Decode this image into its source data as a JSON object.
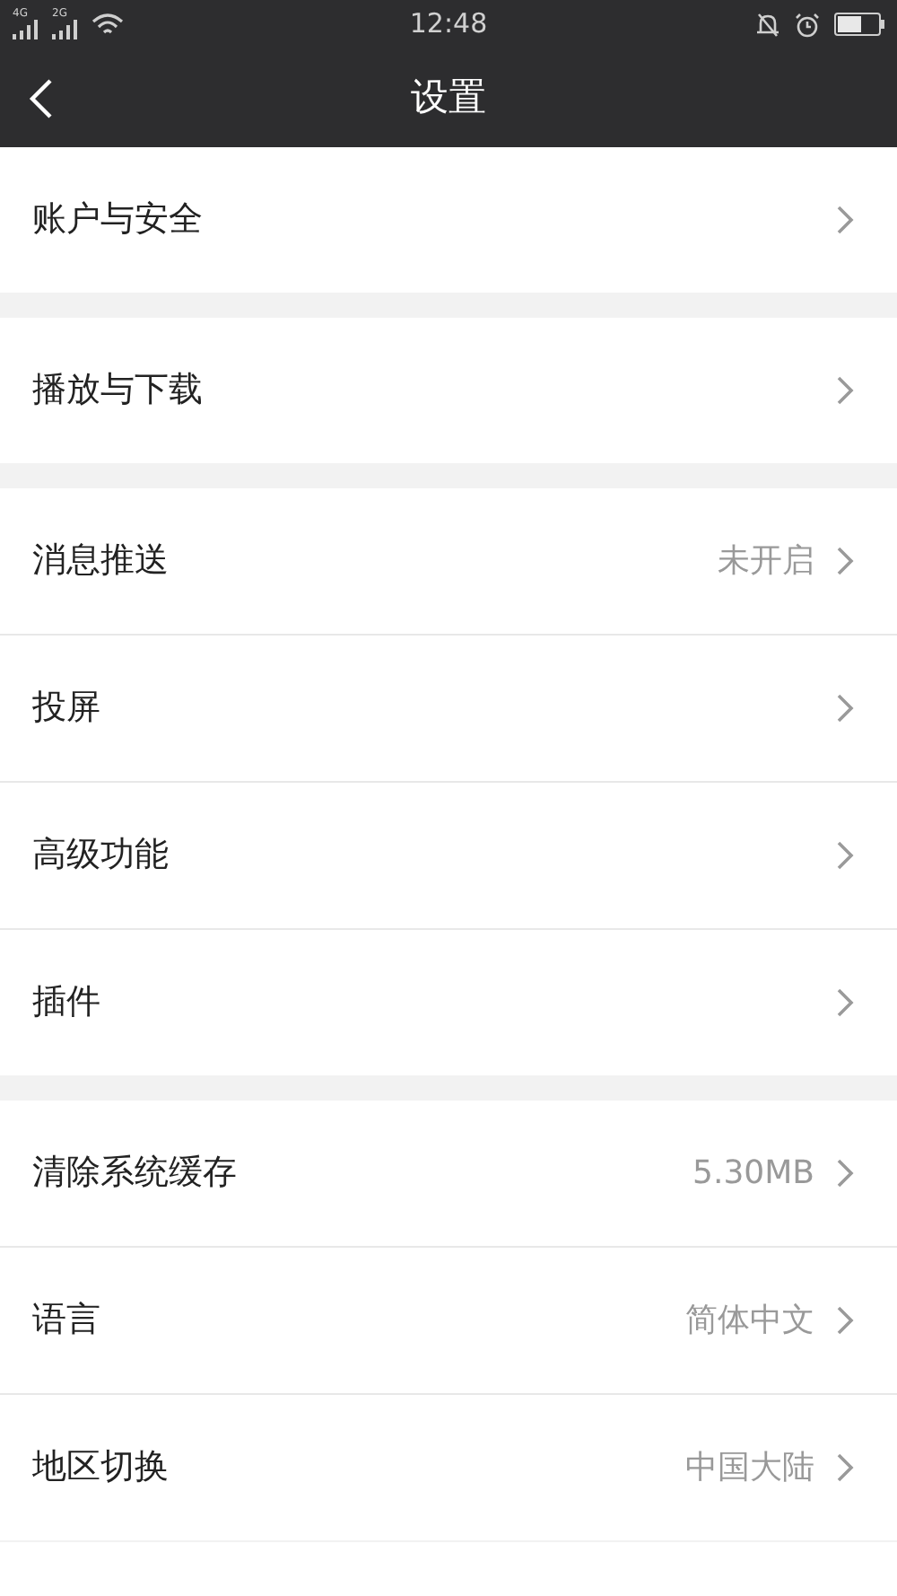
{
  "status_bar": {
    "networks": [
      "4G",
      "2G"
    ],
    "time": "12:48"
  },
  "header": {
    "title": "设置"
  },
  "groups": [
    [
      {
        "label": "账户与安全"
      }
    ],
    [
      {
        "label": "播放与下载"
      }
    ],
    [
      {
        "label": "消息推送",
        "value": "未开启"
      },
      {
        "label": "投屏"
      },
      {
        "label": "高级功能"
      },
      {
        "label": "插件"
      }
    ],
    [
      {
        "label": "清除系统缓存",
        "value": "5.30MB"
      },
      {
        "label": "语言",
        "value": "简体中文"
      },
      {
        "label": "地区切换",
        "value": "中国大陆"
      }
    ]
  ]
}
